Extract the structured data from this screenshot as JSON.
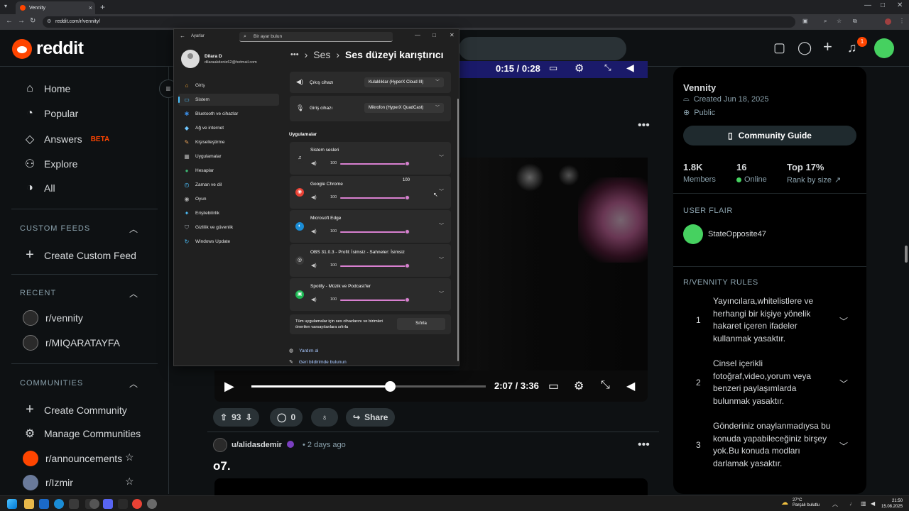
{
  "browser": {
    "tab_title": "Vennity",
    "url": "reddit.com/r/vennity/",
    "new_tab_glyph": "+"
  },
  "reddit": {
    "logo_text": "reddit",
    "notification_count": "1",
    "nav": [
      {
        "label": "Home",
        "icon": "home-icon"
      },
      {
        "label": "Popular",
        "icon": "popular-icon"
      },
      {
        "label": "Answers",
        "icon": "answers-icon",
        "badge": "BETA"
      },
      {
        "label": "Explore",
        "icon": "explore-icon"
      },
      {
        "label": "All",
        "icon": "all-icon"
      }
    ],
    "custom_feeds": {
      "heading": "CUSTOM FEEDS",
      "create_label": "Create Custom Feed"
    },
    "recent": {
      "heading": "RECENT",
      "items": [
        "r/vennity",
        "r/MIQARATAYFA"
      ]
    },
    "communities": {
      "heading": "COMMUNITIES",
      "create_label": "Create Community",
      "manage_label": "Manage Communities",
      "items": [
        "r/announcements",
        "r/Izmir"
      ]
    }
  },
  "video": {
    "top_time": "0:15 / 0:28",
    "time": "2:07 / 3:36",
    "progress_fraction": 0.59
  },
  "post": {
    "votes": "93",
    "comments": "0",
    "share_label": "Share"
  },
  "post2": {
    "user": "u/alidasdemir",
    "time": "• 2 days ago",
    "title": "o7."
  },
  "community": {
    "name": "Vennity",
    "created": "Created Jun 18, 2025",
    "visibility": "Public",
    "guide_label": "Community Guide",
    "stats": [
      {
        "value": "1.8K",
        "label": "Members"
      },
      {
        "value": "16",
        "label": "Online"
      },
      {
        "value": "Top 17%",
        "label": "Rank by size"
      }
    ],
    "user_flair_heading": "USER FLAIR",
    "flair_user": "StateOpposite47",
    "rules_heading": "R/VENNITY RULES",
    "rules": [
      {
        "num": "1",
        "text": "Yayıncılara,whitelistlere ve herhangi bir kişiye yönelik hakaret içeren ifadeler kullanmak yasaktır."
      },
      {
        "num": "2",
        "text": "Cinsel içerikli fotoğraf,video,yorum veya benzeri paylaşımlarda bulunmak yasaktır."
      },
      {
        "num": "3",
        "text": "Gönderiniz onaylanmadıysa bu konuda yapabileceğiniz birşey yok.Bu konuda modları darlamak yasaktır."
      }
    ]
  },
  "settings": {
    "app_title": "Ayarlar",
    "search_placeholder": "Bir ayar bulun",
    "user_name": "Dilara D",
    "user_email": "dilaraakdeniz62@hotmail.com",
    "nav": [
      {
        "label": "Giriş",
        "icon": "home-icon",
        "color": "#f0a030"
      },
      {
        "label": "Sistem",
        "icon": "system-icon",
        "color": "#4cc2ff",
        "active": true
      },
      {
        "label": "Bluetooth ve cihazlar",
        "icon": "bluetooth-icon",
        "color": "#3b8ee8"
      },
      {
        "label": "Ağ ve internet",
        "icon": "network-icon",
        "color": "#6ec6ff"
      },
      {
        "label": "Kişiselleştirme",
        "icon": "brush-icon",
        "color": "#e8a35a"
      },
      {
        "label": "Uygulamalar",
        "icon": "apps-icon",
        "color": "#b0b0b0"
      },
      {
        "label": "Hesaplar",
        "icon": "accounts-icon",
        "color": "#3cb371"
      },
      {
        "label": "Zaman ve dil",
        "icon": "clock-icon",
        "color": "#4cc2ff"
      },
      {
        "label": "Oyun",
        "icon": "gamepad-icon",
        "color": "#b0b0b0"
      },
      {
        "label": "Erişilebilirlik",
        "icon": "accessibility-icon",
        "color": "#4cc2ff"
      },
      {
        "label": "Gizlilik ve güvenlik",
        "icon": "shield-icon",
        "color": "#9aa0a6"
      },
      {
        "label": "Windows Update",
        "icon": "update-icon",
        "color": "#4cc2ff"
      }
    ],
    "breadcrumb": {
      "more": "•••",
      "parent": "Ses",
      "current": "Ses düzeyi karıştırıcı"
    },
    "output": {
      "label": "Çıkış cihazı",
      "value": "Kulaklıklar (HyperX Cloud III)"
    },
    "input": {
      "label": "Giriş cihazı",
      "value": "Mikrofon (HyperX QuadCast)"
    },
    "apps_heading": "Uygulamalar",
    "apps": [
      {
        "name": "Sistem sesleri",
        "volume": "100",
        "icon": "headphones-icon",
        "color": "#2b2b2b"
      },
      {
        "name": "Google Chrome",
        "volume": "100",
        "icon": "chrome-icon",
        "color": "#e94235"
      },
      {
        "name": "Microsoft Edge",
        "volume": "100",
        "icon": "edge-icon",
        "color": "#1b8dd6"
      },
      {
        "name": "OBS 31.0.3 - Profil: İsimsiz - Sahneler: İsimsiz",
        "volume": "100",
        "icon": "obs-icon",
        "color": "#3a3a3a"
      },
      {
        "name": "Spotify - Müzik ve Podcast'ler",
        "volume": "100",
        "icon": "spotify-icon",
        "color": "#1db954"
      }
    ],
    "tooltip_value": "100",
    "reset_text": "Tüm uygulamalar için ses cihazlarını ve birimleri önerilen varsayılanlara sıfırla",
    "reset_button": "Sıfırla",
    "help_link": "Yardım al",
    "feedback_link": "Geri bildirimde bulunun"
  },
  "taskbar": {
    "temperature": "27°C",
    "weather": "Parçalı bulutlu",
    "time": "21:50",
    "date": "15.08.2025"
  },
  "colors": {
    "reddit_orange": "#ff4500",
    "online_green": "#46d160",
    "slider_accent": "#d880d0"
  }
}
